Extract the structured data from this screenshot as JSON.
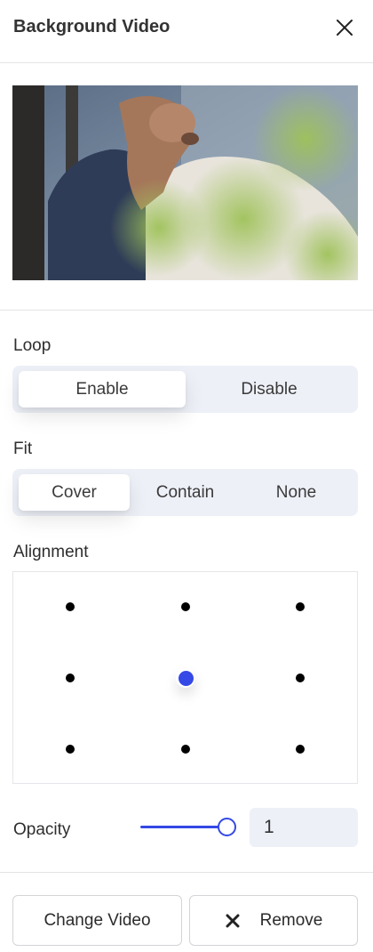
{
  "header": {
    "title": "Background Video",
    "close_icon": "close-icon"
  },
  "preview": {
    "description_icon": "video-thumbnail"
  },
  "loop": {
    "label": "Loop",
    "options": [
      "Enable",
      "Disable"
    ],
    "selected": "Enable"
  },
  "fit": {
    "label": "Fit",
    "options": [
      "Cover",
      "Contain",
      "None"
    ],
    "selected": "Cover"
  },
  "alignment": {
    "label": "Alignment",
    "selected": "center",
    "positions": [
      "top-left",
      "top-center",
      "top-right",
      "center-left",
      "center",
      "center-right",
      "bottom-left",
      "bottom-center",
      "bottom-right"
    ]
  },
  "opacity": {
    "label": "Opacity",
    "value": "1",
    "slider_fraction": 1.0
  },
  "actions": {
    "change_label": "Change Video",
    "remove_label": "Remove",
    "remove_icon": "close-icon"
  },
  "colors": {
    "accent": "#3449e6",
    "segment_bg": "#eef0f8",
    "border": "#e4e4e7"
  }
}
